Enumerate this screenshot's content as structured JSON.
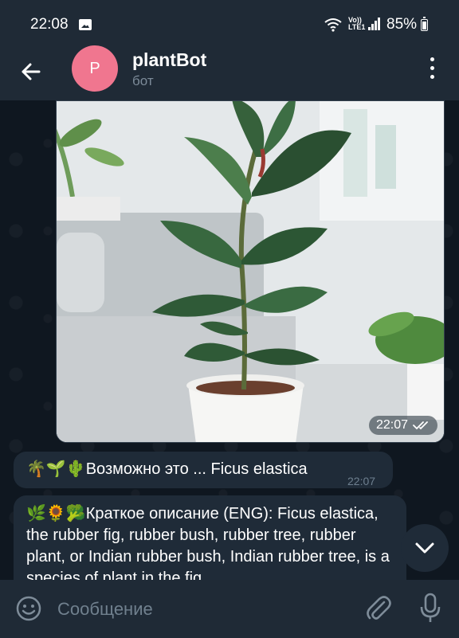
{
  "status": {
    "time": "22:08",
    "volte_top": "Vo))",
    "volte_bottom": "LTE1",
    "battery": "85%"
  },
  "header": {
    "avatar_letter": "P",
    "title": "plantBot",
    "subtitle": "бот"
  },
  "messages": {
    "photo": {
      "time": "22:07"
    },
    "guess": {
      "emoji": "🌴🌱🌵",
      "text": "Возможно это ... Ficus elastica",
      "time": "22:07"
    },
    "description": {
      "emoji": "🌿🌻🥦",
      "text": "Краткое описание (ENG): Ficus elastica, the rubber fig, rubber bush, rubber tree, rubber plant, or Indian rubber bush, Indian rubber tree, is a species of plant in the fig"
    }
  },
  "input": {
    "placeholder": "Сообщение"
  },
  "colors": {
    "header_bg": "#1f2a36",
    "chat_bg": "#0f1720",
    "bubble_bg": "#1f2b38",
    "avatar": "#f0768f",
    "muted_text": "#7c8b99"
  }
}
